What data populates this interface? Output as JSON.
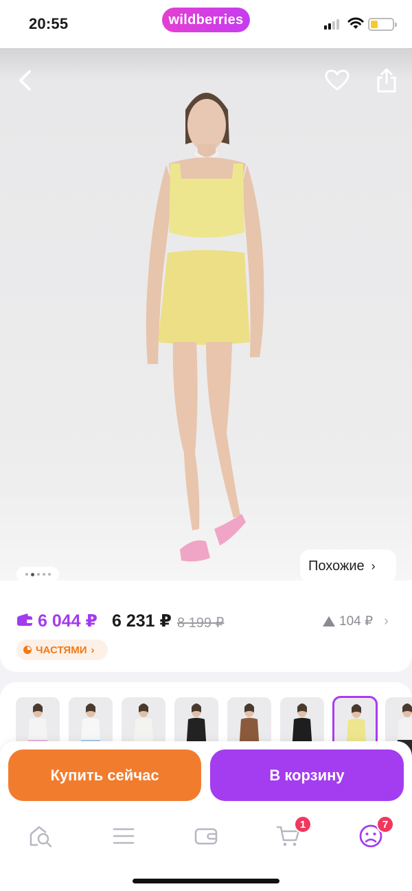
{
  "status_bar": {
    "time": "20:55",
    "brand": "wildberries"
  },
  "product": {
    "image_alt": "Yellow corset top and mini skirt set",
    "gallery_count": 5,
    "gallery_active_index": 1,
    "similar_label": "Похожие"
  },
  "price": {
    "wallet_price": "6 044 ₽",
    "price": "6 231 ₽",
    "old_price": "8 199 ₽",
    "diff": "104 ₽",
    "installments_label": "ЧАСТЯМИ"
  },
  "variants": [
    {
      "top": "#f4f4f4",
      "bottom": "#e8b3d8"
    },
    {
      "top": "#f7f7f7",
      "bottom": "#a8c8ec"
    },
    {
      "top": "#f3f3f0",
      "bottom": "#f3f3f0"
    },
    {
      "top": "#222222",
      "bottom": "#222222"
    },
    {
      "top": "#8b5a3c",
      "bottom": "#8b5a3c"
    },
    {
      "top": "#1e1e1e",
      "bottom": "#1e1e1e"
    },
    {
      "top": "#eee58f",
      "bottom": "#eee58f"
    },
    {
      "top": "#f2f2f2",
      "bottom": "#2a2a2a"
    }
  ],
  "actions": {
    "buy_now": "Купить сейчас",
    "add_to_cart": "В корзину"
  },
  "tabbar": {
    "cart_badge": "1",
    "profile_badge": "7"
  },
  "colors": {
    "brand_purple": "#a43cf0",
    "buy_orange": "#f27c2d",
    "badge_red": "#f0385c"
  }
}
